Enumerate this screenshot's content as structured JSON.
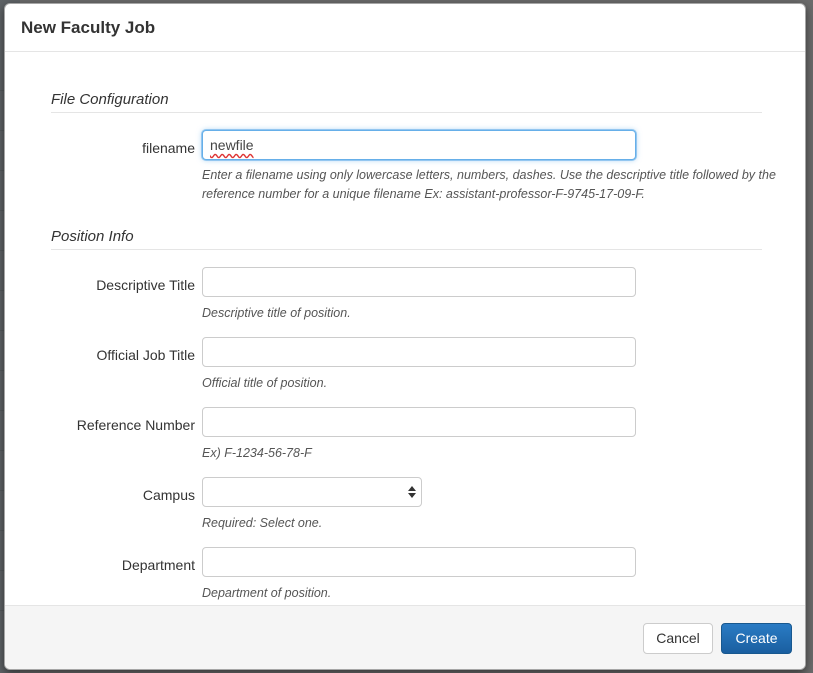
{
  "modal": {
    "title": "New Faculty Job"
  },
  "sections": {
    "file_configuration": "File Configuration",
    "position_info": "Position Info"
  },
  "fields": {
    "filename": {
      "label": "filename",
      "value": "newfile",
      "help": "Enter a filename using only lowercase letters, numbers, dashes. Use the descriptive title followed by the reference number for a unique filename Ex: assistant-professor-F-9745-17-09-F."
    },
    "descriptive_title": {
      "label": "Descriptive Title",
      "value": "",
      "help": "Descriptive title of position."
    },
    "official_job_title": {
      "label": "Official Job Title",
      "value": "",
      "help": "Official title of position."
    },
    "reference_number": {
      "label": "Reference Number",
      "value": "",
      "help": "Ex) F-1234-56-78-F"
    },
    "campus": {
      "label": "Campus",
      "value": "",
      "help": "Required: Select one."
    },
    "department": {
      "label": "Department",
      "value": "",
      "help": "Department of position."
    }
  },
  "footer": {
    "cancel_label": "Cancel",
    "create_label": "Create"
  },
  "colors": {
    "primary": "#1f6cb0",
    "focus": "#66afe9"
  }
}
